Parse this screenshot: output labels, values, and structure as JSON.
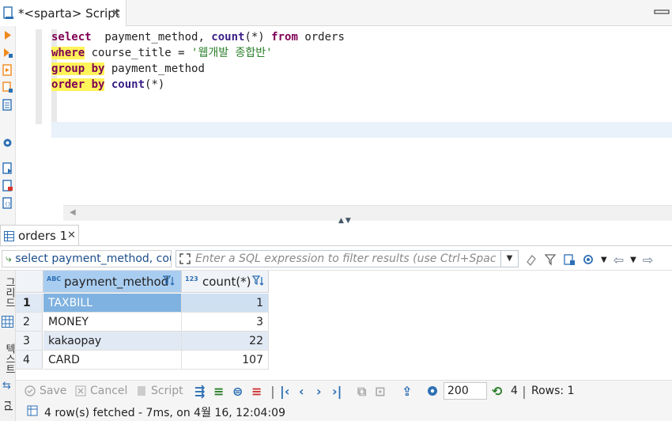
{
  "tab": {
    "title": "*<sparta> Script",
    "close": "✕"
  },
  "editor": {
    "lines": [
      [
        {
          "t": "select",
          "c": "kw"
        },
        {
          "t": "  payment_method, ",
          "c": ""
        },
        {
          "t": "count",
          "c": "fn"
        },
        {
          "t": "(*) ",
          "c": ""
        },
        {
          "t": "from",
          "c": "kw"
        },
        {
          "t": " orders",
          "c": ""
        }
      ],
      [
        {
          "t": "where",
          "c": "kw hl"
        },
        {
          "t": " course_title = ",
          "c": ""
        },
        {
          "t": "'웹개발 종합반'",
          "c": "str"
        }
      ],
      [
        {
          "t": "group by",
          "c": "kw hl"
        },
        {
          "t": " payment_method",
          "c": ""
        }
      ],
      [
        {
          "t": "order by",
          "c": "kw hl"
        },
        {
          "t": " ",
          "c": ""
        },
        {
          "t": "count",
          "c": "fn"
        },
        {
          "t": "(*)",
          "c": ""
        }
      ]
    ]
  },
  "result_tab": {
    "label": "orders 1",
    "close": "✕"
  },
  "filter": {
    "query_text": "select payment_method, cou",
    "expression_placeholder": "Enter a SQL expression to filter results (use Ctrl+Spac",
    "dropdown": "▼"
  },
  "side_labels": {
    "grid": "그리드",
    "text": "텍스트",
    "record": "rd"
  },
  "grid": {
    "columns": [
      {
        "name": "payment_method",
        "type_badge": "ABC"
      },
      {
        "name": "count(*)",
        "type_badge": "123"
      }
    ],
    "rows": [
      {
        "num": "1",
        "payment_method": "TAXBILL",
        "count": "1"
      },
      {
        "num": "2",
        "payment_method": "MONEY",
        "count": "3"
      },
      {
        "num": "3",
        "payment_method": "kakaopay",
        "count": "22"
      },
      {
        "num": "4",
        "payment_method": "CARD",
        "count": "107"
      }
    ]
  },
  "bottom": {
    "save": "Save",
    "cancel": "Cancel",
    "script": "Script",
    "fetch_size": "200",
    "refresh_count": "4",
    "rows": "Rows: 1"
  },
  "status": {
    "text": "4 row(s) fetched - 7ms, on 4월 16, 12:04:09"
  },
  "colors": {
    "keyword": "#7f0055",
    "highlight": "#fff45a",
    "accent": "#2d6fb4",
    "selected": "#a9cdf0"
  }
}
